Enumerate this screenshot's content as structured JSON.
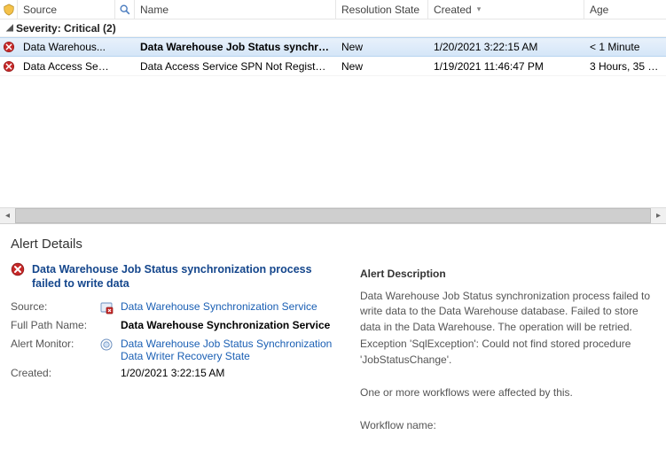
{
  "columns": {
    "source": "Source",
    "name": "Name",
    "resolution": "Resolution State",
    "created": "Created",
    "age": "Age"
  },
  "group": {
    "label": "Severity: Critical (2)"
  },
  "rows": [
    {
      "source": "Data Warehous...",
      "name": "Data Warehouse Job Status synchronization ...",
      "resolution": "New",
      "created": "1/20/2021 3:22:15 AM",
      "age": "< 1 Minute",
      "selected": true
    },
    {
      "source": "Data Access Ser...",
      "name": "Data Access Service SPN Not Registered",
      "resolution": "New",
      "created": "1/19/2021 11:46:47 PM",
      "age": "3 Hours, 35 Mi...",
      "selected": false
    }
  ],
  "details": {
    "pane_title": "Alert Details",
    "title": "Data Warehouse Job Status synchronization process failed to write data",
    "labels": {
      "source": "Source:",
      "full_path": "Full Path Name:",
      "monitor": "Alert Monitor:",
      "created": "Created:"
    },
    "source": "Data Warehouse Synchronization Service",
    "full_path": "Data Warehouse Synchronization Service",
    "monitor": "Data Warehouse Job Status Synchronization Data Writer Recovery State",
    "created": "1/20/2021 3:22:15 AM",
    "desc_heading": "Alert Description",
    "desc_p1": "Data Warehouse Job Status synchronization process failed to write data to the Data Warehouse database. Failed to store data in the Data Warehouse. The operation will be retried.",
    "desc_p2": "Exception 'SqlException': Could not find stored procedure 'JobStatusChange'.",
    "desc_p3": "One or more workflows were affected by this.",
    "desc_p4": "Workflow name:"
  }
}
